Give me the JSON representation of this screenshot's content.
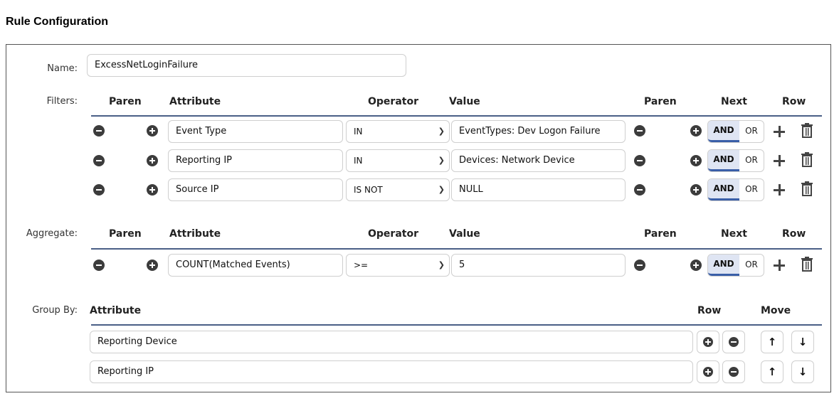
{
  "title": "Rule Configuration",
  "name": {
    "label": "Name:",
    "value": "ExcessNetLoginFailure"
  },
  "filters": {
    "label": "Filters:",
    "headers": {
      "paren_open": "Paren",
      "attribute": "Attribute",
      "operator": "Operator",
      "value": "Value",
      "paren_close": "Paren",
      "next": "Next",
      "row": "Row"
    },
    "rows": [
      {
        "attribute": "Event Type",
        "operator": "IN",
        "value": "EventTypes: Dev Logon Failure",
        "and": "AND",
        "or": "OR"
      },
      {
        "attribute": "Reporting IP",
        "operator": "IN",
        "value": "Devices: Network Device",
        "and": "AND",
        "or": "OR"
      },
      {
        "attribute": "Source IP",
        "operator": "IS NOT",
        "value": "NULL",
        "and": "AND",
        "or": "OR"
      }
    ]
  },
  "aggregate": {
    "label": "Aggregate:",
    "headers": {
      "paren_open": "Paren",
      "attribute": "Attribute",
      "operator": "Operator",
      "value": "Value",
      "paren_close": "Paren",
      "next": "Next",
      "row": "Row"
    },
    "rows": [
      {
        "attribute": "COUNT(Matched Events)",
        "operator": ">=",
        "value": "5",
        "and": "AND",
        "or": "OR"
      }
    ]
  },
  "group_by": {
    "label": "Group By:",
    "headers": {
      "attribute": "Attribute",
      "row": "Row",
      "move": "Move"
    },
    "rows": [
      {
        "attribute": "Reporting Device",
        "up": "↑",
        "down": "↓"
      },
      {
        "attribute": "Reporting IP",
        "up": "↑",
        "down": "↓"
      }
    ]
  },
  "icons": [
    "minus-circle-icon",
    "plus-circle-icon",
    "plus-icon",
    "trash-icon",
    "chevron-down-icon",
    "arrow-up-icon",
    "arrow-down-icon"
  ],
  "colors": {
    "accent": "#3a5fa8",
    "divider": "#4a5f86",
    "toggle_active_bg": "#dfe5f3"
  }
}
